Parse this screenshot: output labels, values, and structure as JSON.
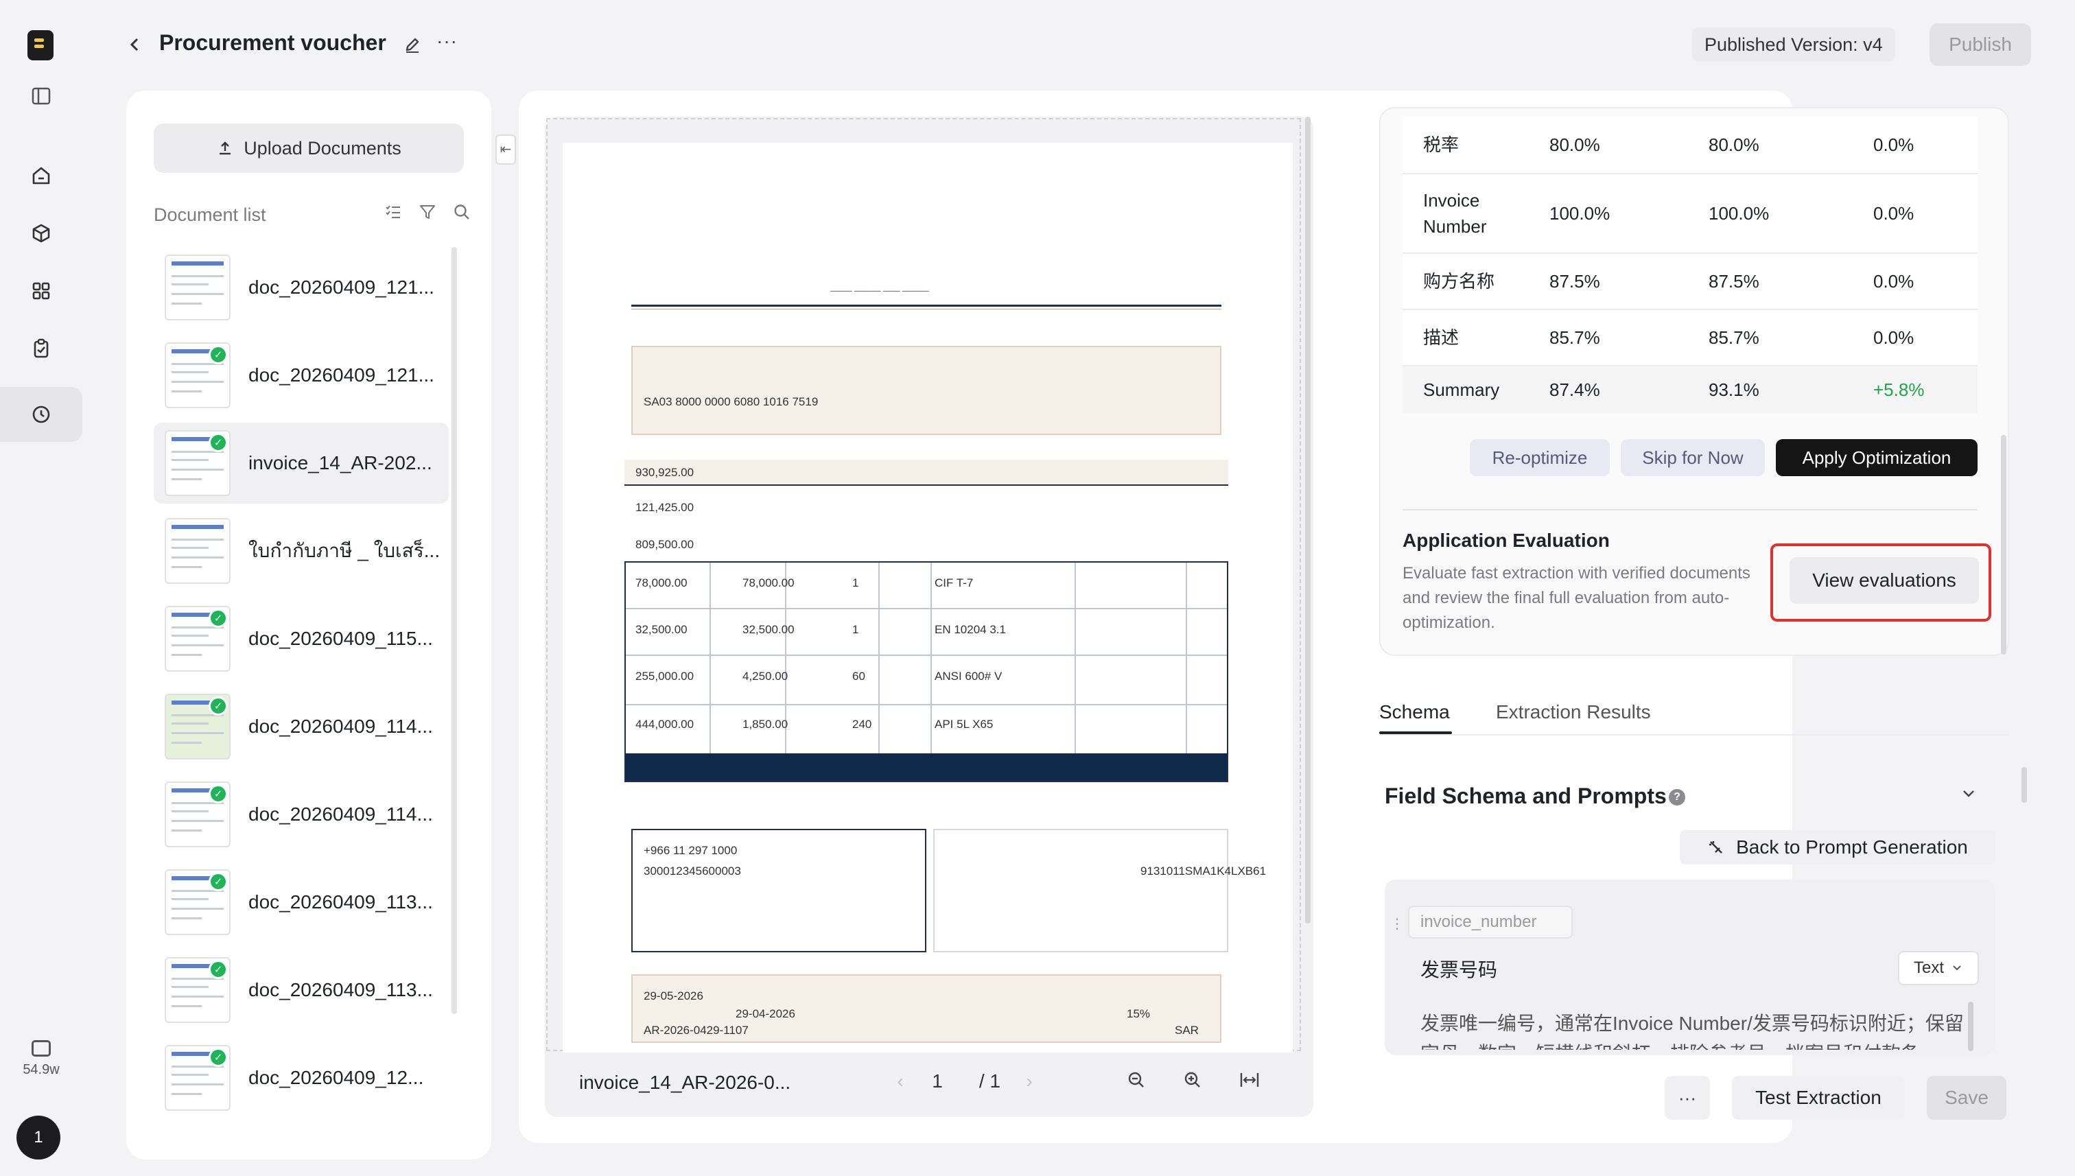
{
  "header": {
    "title": "Procurement voucher",
    "published_version": "Published Version: v4",
    "publish_label": "Publish"
  },
  "rail": {
    "credits": "54.9w",
    "avatar_text": "1"
  },
  "documents": {
    "upload_label": "Upload Documents",
    "list_label": "Document list",
    "items": [
      {
        "name": "doc_20260409_121...",
        "verified": false
      },
      {
        "name": "doc_20260409_121...",
        "verified": true
      },
      {
        "name": "invoice_14_AR-202...",
        "verified": true
      },
      {
        "name": "ใบกำกับภาษี _ ใบเสร็...",
        "verified": false
      },
      {
        "name": "doc_20260409_115...",
        "verified": true
      },
      {
        "name": "doc_20260409_114...",
        "verified": true
      },
      {
        "name": "doc_20260409_114...",
        "verified": true
      },
      {
        "name": "doc_20260409_113...",
        "verified": true
      },
      {
        "name": "doc_20260409_113...",
        "verified": true
      },
      {
        "name": "doc_20260409_12...",
        "verified": true
      }
    ]
  },
  "viewer": {
    "file_name": "invoice_14_AR-2026-0...",
    "current_page": "1",
    "total_pages": "/ 1",
    "page_text": {
      "amount_1": "930,925.00",
      "amount_2": "121,425.00",
      "amount_3": "809,500.00",
      "iban": "SA03 8000 0000 6080 1016 7519",
      "ref_1": "300012345600003",
      "phone": "+966 11 297 1000",
      "cr_no": "9131011SMA1K4LXB61",
      "invoice_no": "AR-2026-0429-1107",
      "date_1": "29-04-2026",
      "date_2": "29-05-2026",
      "currency": "SAR",
      "vat": "15%",
      "rows": [
        {
          "total": "78,000.00",
          "price": "78,000.00",
          "qty": "1",
          "item": "CIF T-7"
        },
        {
          "total": "32,500.00",
          "price": "32,500.00",
          "qty": "1",
          "item": "EN 10204 3.1"
        },
        {
          "total": "255,000.00",
          "price": "4,250.00",
          "qty": "60",
          "item": "ANSI 600# V"
        },
        {
          "total": "444,000.00",
          "price": "1,850.00",
          "qty": "240",
          "item": "API 5L X65"
        }
      ]
    }
  },
  "optimization": {
    "metrics": [
      {
        "name": "税率",
        "a": "80.0%",
        "b": "80.0%",
        "c": "0.0%"
      },
      {
        "name": "Invoice Number",
        "a": "100.0%",
        "b": "100.0%",
        "c": "0.0%"
      },
      {
        "name": "购方名称",
        "a": "87.5%",
        "b": "87.5%",
        "c": "0.0%"
      },
      {
        "name": "描述",
        "a": "85.7%",
        "b": "85.7%",
        "c": "0.0%"
      },
      {
        "name": "Summary",
        "a": "87.4%",
        "b": "93.1%",
        "c": "+5.8%"
      }
    ],
    "reoptimize_label": "Re-optimize",
    "skip_label": "Skip for Now",
    "apply_label": "Apply Optimization",
    "app_eval_title": "Application Evaluation",
    "app_eval_desc": "Evaluate fast extraction with verified documents and review the final full evaluation from auto-optimization.",
    "view_eval_label": "View evaluations"
  },
  "tabs": [
    {
      "label": "Schema",
      "active": true
    },
    {
      "label": "Extraction Results",
      "active": false
    }
  ],
  "schema": {
    "title": "Field Schema and Prompts",
    "back_to_prompt_label": "Back to Prompt Generation",
    "field": {
      "key": "invoice_number",
      "label": "发票号码",
      "type": "Text",
      "description": "发票唯一编号，通常在Invoice Number/发票号码标识附近；保留字母、数字、短横线和斜杠，排除参考号、档案号和付款条"
    }
  },
  "footer": {
    "more_label": "···",
    "test_label": "Test Extraction",
    "save_label": "Save"
  }
}
